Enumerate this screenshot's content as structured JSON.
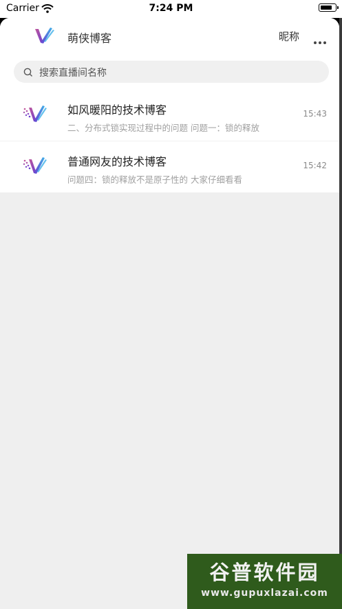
{
  "status_bar": {
    "carrier": "Carrier",
    "time": "7:24 PM",
    "battery_level": 0.85
  },
  "header": {
    "app_title": "萌侠博客",
    "nickname": "昵称",
    "more_icon": "ellipsis-icon",
    "logo_icon": "v-logo-icon"
  },
  "search": {
    "placeholder": "搜索直播间名称",
    "icon": "search-icon"
  },
  "conversations": [
    {
      "title": "如风暖阳的技术博客",
      "preview": "二、分布式锁实现过程中的问题 问题一：锁的释放",
      "time": "15:43"
    },
    {
      "title": "普通网友的技术博客",
      "preview": "问题四：锁的释放不是原子性的 大家仔细看看",
      "time": "15:42"
    }
  ],
  "watermark": {
    "name": "谷普软件园",
    "url": "www.gupuxlazai.com"
  },
  "colors": {
    "logo_purple": "#6b3fd0",
    "logo_blue": "#3fb0e8",
    "logo_pink": "#c0579c",
    "page_bg": "#efefef",
    "watermark_green": "#2f5b1c"
  }
}
